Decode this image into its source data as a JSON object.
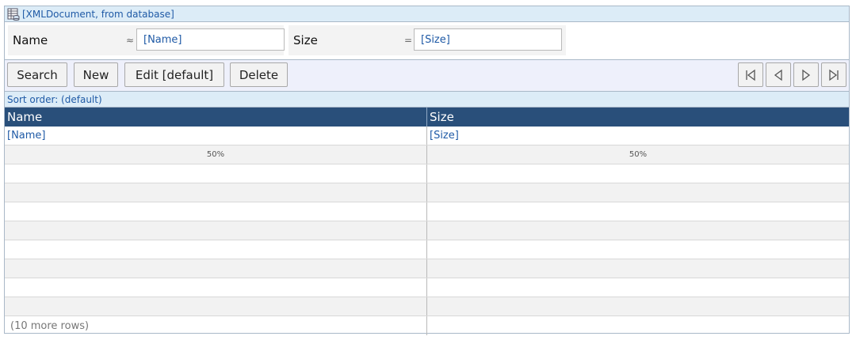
{
  "title": "[XMLDocument, from database]",
  "filters": [
    {
      "label": "Name",
      "operator": "≈",
      "value": "[Name]"
    },
    {
      "label": "Size",
      "operator": "=",
      "value": "[Size]"
    }
  ],
  "toolbar": {
    "search_label": "Search",
    "new_label": "New",
    "edit_label": "Edit [default]",
    "delete_label": "Delete"
  },
  "nav_icons": [
    "first-page-icon",
    "previous-page-icon",
    "next-page-icon",
    "last-page-icon"
  ],
  "sort_order": "Sort order: (default)",
  "grid": {
    "columns": [
      "Name",
      "Size"
    ],
    "template_row": [
      "[Name]",
      "[Size]"
    ],
    "widths": [
      "50%",
      "50%"
    ],
    "more_rows": "(10 more rows)"
  },
  "colors": {
    "header_bg": "#294f7a",
    "link_text": "#1f5aa6",
    "title_bar_bg": "#dcecf7",
    "toolbar_bg": "#eef0fb"
  }
}
